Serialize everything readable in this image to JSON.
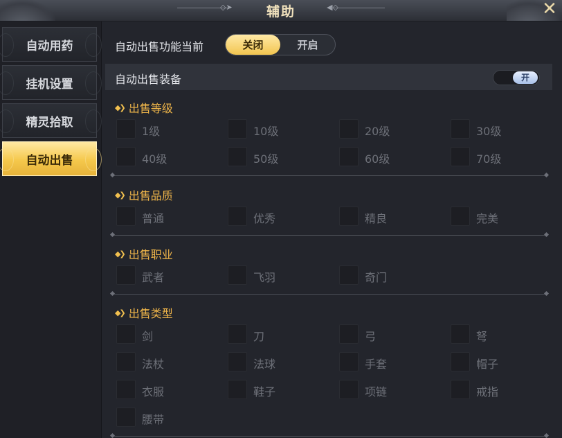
{
  "window": {
    "title": "辅助",
    "close_icon": "close-x-icon"
  },
  "sidebar": {
    "items": [
      {
        "label": "自动用药",
        "active": false
      },
      {
        "label": "挂机设置",
        "active": false
      },
      {
        "label": "精灵拾取",
        "active": false
      },
      {
        "label": "自动出售",
        "active": true
      }
    ]
  },
  "auto_sell": {
    "master_label": "自动出售功能当前",
    "options": [
      {
        "label": "关闭",
        "selected": true
      },
      {
        "label": "开启",
        "selected": false
      }
    ]
  },
  "equip_sell": {
    "label": "自动出售装备",
    "toggle_label": "开",
    "toggle_on": true
  },
  "sections": [
    {
      "title": "出售等级",
      "items": [
        "1级",
        "10级",
        "20级",
        "30级",
        "40级",
        "50级",
        "60级",
        "70级"
      ]
    },
    {
      "title": "出售品质",
      "items": [
        "普通",
        "优秀",
        "精良",
        "完美"
      ]
    },
    {
      "title": "出售职业",
      "items": [
        "武者",
        "飞羽",
        "奇门"
      ]
    },
    {
      "title": "出售类型",
      "items": [
        "剑",
        "刀",
        "弓",
        "弩",
        "法杖",
        "法球",
        "手套",
        "帽子",
        "衣服",
        "鞋子",
        "项链",
        "戒指",
        "腰带"
      ]
    }
  ],
  "colors": {
    "accent_gold": "#f2c550",
    "section_title": "#f0b64a",
    "panel_bg": "#23252c"
  }
}
